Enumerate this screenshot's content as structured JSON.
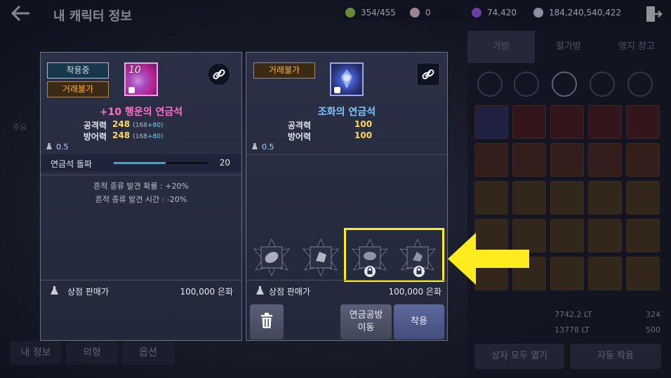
{
  "header": {
    "title": "내 캐릭터 정보",
    "currencies": [
      {
        "id": "energy",
        "value": "354/455",
        "color": "#9fd14a"
      },
      {
        "id": "pearl",
        "value": "0",
        "color": "#e7c9d4"
      },
      {
        "id": "crystal",
        "value": "74,420",
        "color": "#9a5cf0"
      },
      {
        "id": "silver",
        "value": "184,240,540,422",
        "color": "#cfd6e8"
      }
    ]
  },
  "left_menu": {
    "section_label": "주요",
    "pager_prev": "‹",
    "pager_next": "›"
  },
  "bottom_tabs": [
    "내 정보",
    "외형",
    "옵션"
  ],
  "inventory": {
    "tabs": [
      "가방",
      "펄가방",
      "영지 창고"
    ],
    "weight": "7742.2 LT",
    "weight_max": "13778 LT",
    "slots_used": "324",
    "slots_max": "500",
    "open_all_label": "상자 모두 열기",
    "auto_equip_label": "자동 착용"
  },
  "equipped_item": {
    "status_tag": "착용중",
    "trade_tag": "거래불가",
    "enhance": "10",
    "name": "+10 행운의 연금석",
    "attack_label": "공격력",
    "attack_value": "248",
    "attack_base": "168",
    "attack_bonus": "+80",
    "defense_label": "방어력",
    "defense_value": "248",
    "defense_base": "168",
    "defense_bonus": "+80",
    "weight": "0.5",
    "breakthrough_label": "연금석 돌파",
    "breakthrough_value": "20",
    "breakthrough_fill": 0.55,
    "effects": [
      "흔적 종류 발견 확률 : +20%",
      "흔적 종류 발견 시간 : -20%"
    ],
    "sell_label": "상점 판매가",
    "sell_price": "100,000 은화"
  },
  "compare_item": {
    "trade_tag": "거래불가",
    "name": "조화의 연금석",
    "attack_label": "공격력",
    "attack_value": "100",
    "defense_label": "방어력",
    "defense_value": "100",
    "weight": "0.5",
    "sell_label": "상점 판매가",
    "sell_price": "100,000 은화",
    "slots": [
      {
        "locked": false
      },
      {
        "locked": false
      },
      {
        "locked": true
      },
      {
        "locked": true
      }
    ]
  },
  "actions": {
    "alchemy_line1": "연금공방",
    "alchemy_line2": "이동",
    "equip_label": "착용"
  }
}
